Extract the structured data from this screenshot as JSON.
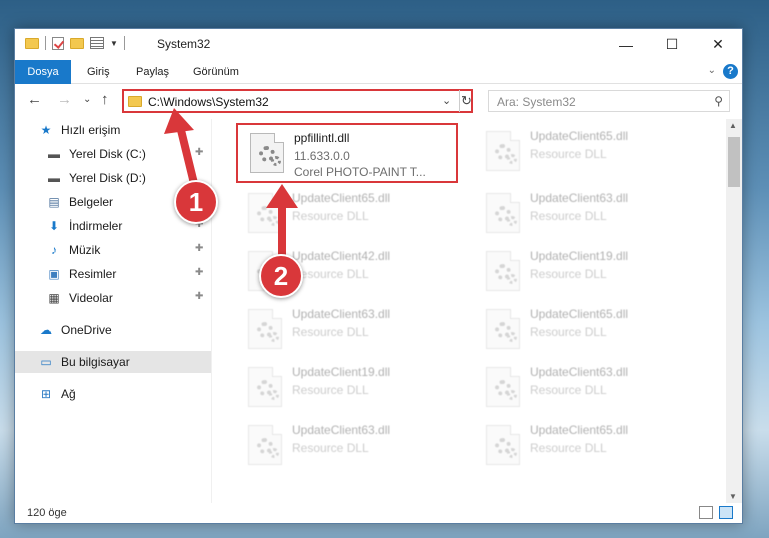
{
  "window": {
    "title": "System32",
    "minimize": "—",
    "maximize": "☐",
    "close": "✕"
  },
  "ribbon": {
    "tabs": [
      "Dosya",
      "Giriş",
      "Paylaş",
      "Görünüm"
    ],
    "help": "?",
    "collapse": "⌄"
  },
  "nav": {
    "back": "←",
    "forward": "→",
    "recent": "⌄",
    "up": "↑",
    "address": "C:\\Windows\\System32",
    "dropdown": "⌄",
    "refresh": "↻",
    "search_placeholder": "Ara: System32",
    "search_icon": "⚲"
  },
  "sidebar": {
    "items": [
      {
        "label": "Hızlı erişim",
        "icon": "star-icon",
        "glyph": "★",
        "pinned": false
      },
      {
        "label": "Yerel Disk (C:)",
        "icon": "drive-icon",
        "glyph": "▬",
        "pinned": true
      },
      {
        "label": "Yerel Disk (D:)",
        "icon": "drive-icon",
        "glyph": "▬",
        "pinned": false
      },
      {
        "label": "Belgeler",
        "icon": "documents-icon",
        "glyph": "▤",
        "pinned": true
      },
      {
        "label": "İndirmeler",
        "icon": "download-icon",
        "glyph": "⬇",
        "pinned": true
      },
      {
        "label": "Müzik",
        "icon": "music-icon",
        "glyph": "♪",
        "pinned": true
      },
      {
        "label": "Resimler",
        "icon": "pictures-icon",
        "glyph": "▣",
        "pinned": true
      },
      {
        "label": "Videolar",
        "icon": "video-icon",
        "glyph": "▦",
        "pinned": true
      },
      {
        "label": "OneDrive",
        "icon": "cloud-icon",
        "glyph": "☁",
        "pinned": false
      },
      {
        "label": "Bu bilgisayar",
        "icon": "computer-icon",
        "glyph": "▭",
        "pinned": false
      },
      {
        "label": "Ağ",
        "icon": "network-icon",
        "glyph": "⊞",
        "pinned": false
      }
    ],
    "pin_glyph": "📌"
  },
  "files": [
    {
      "name": "ppfillintl.dll",
      "line2": "11.633.0.0",
      "line3": "Corel PHOTO-PAINT T...",
      "faded": false
    },
    {
      "name": "UpdateClient65.dll",
      "line2": "Resource DLL",
      "line3": "",
      "faded": true
    },
    {
      "name": "UpdateClient65.dll",
      "line2": "Resource DLL",
      "line3": "",
      "faded": true
    },
    {
      "name": "UpdateClient63.dll",
      "line2": "Resource DLL",
      "line3": "",
      "faded": true
    },
    {
      "name": "UpdateClient42.dll",
      "line2": "Resource DLL",
      "line3": "",
      "faded": true
    },
    {
      "name": "UpdateClient19.dll",
      "line2": "Resource DLL",
      "line3": "",
      "faded": true
    },
    {
      "name": "UpdateClient63.dll",
      "line2": "Resource DLL",
      "line3": "",
      "faded": true
    },
    {
      "name": "UpdateClient65.dll",
      "line2": "Resource DLL",
      "line3": "",
      "faded": true
    },
    {
      "name": "UpdateClient19.dll",
      "line2": "Resource DLL",
      "line3": "",
      "faded": true
    },
    {
      "name": "UpdateClient63.dll",
      "line2": "Resource DLL",
      "line3": "",
      "faded": true
    },
    {
      "name": "UpdateClient63.dll",
      "line2": "Resource DLL",
      "line3": "",
      "faded": true
    },
    {
      "name": "UpdateClient65.dll",
      "line2": "Resource DLL",
      "line3": "",
      "faded": true
    }
  ],
  "status": {
    "count": "120 öge"
  },
  "annotations": {
    "step1": "1",
    "step2": "2"
  },
  "colors": {
    "accent": "#1979ca",
    "highlight": "#d9373a"
  }
}
